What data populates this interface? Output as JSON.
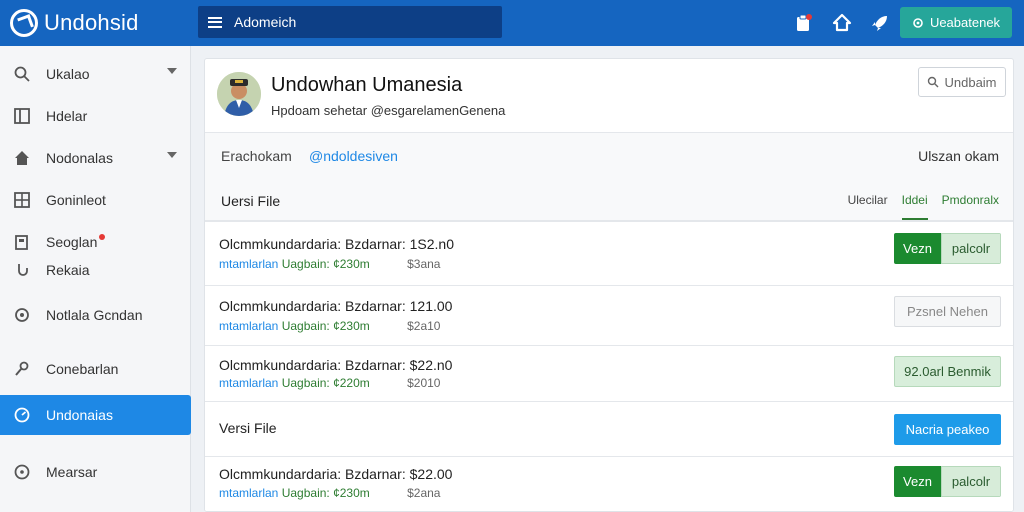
{
  "topbar": {
    "brand": "Undohsid",
    "search_text": "Adomeich",
    "action_button": "Ueabatenek",
    "icons": [
      "clipboard-alert-icon",
      "home-icon",
      "rocket-icon"
    ]
  },
  "sidebar": {
    "items": [
      {
        "label": "Ukalao",
        "icon": "search-icon",
        "chevron": true
      },
      {
        "label": "Hdelar",
        "icon": "panel-icon",
        "chevron": false
      },
      {
        "label": "Nodonalas",
        "icon": "home-icon",
        "chevron": true
      },
      {
        "label": "Goninleot",
        "icon": "grid-icon",
        "chevron": false
      },
      {
        "label": "Seoglan",
        "icon": "document-icon",
        "chevron": false,
        "dot": true
      },
      {
        "label": "Rekaia",
        "icon": "hook-icon",
        "chevron": false
      },
      {
        "label": "Notlala Gcndan",
        "icon": "gear-icon",
        "chevron": false
      },
      {
        "label": "Conebarlan",
        "icon": "wrench-icon",
        "chevron": false
      },
      {
        "label": "Undonaias",
        "icon": "compass-icon",
        "chevron": false,
        "active": true
      },
      {
        "label": "Mearsar",
        "icon": "info-icon",
        "chevron": false
      }
    ]
  },
  "profile": {
    "name": "Undowhan Umanesia",
    "subtitle": "Hpdoam sehetar @esgarelamenGenena",
    "button": "Undbaim"
  },
  "meta": {
    "left": "Erachokam",
    "link": "@ndoldesiven",
    "right": "Ulszan okam"
  },
  "section": {
    "title": "Uersi File",
    "tabs": [
      "Ulecilar",
      "Iddei",
      "Pmdonralx"
    ]
  },
  "rows": [
    {
      "line1": "Olcmmkundardaria: Bzdarnar: 1S2.n0",
      "a": "mtamlarlan",
      "b": "Uagbain: ¢230m",
      "c": "$3ana",
      "button_type": "pair",
      "btn1": "Vezn",
      "btn2": "palcolr"
    },
    {
      "line1": "Olcmmkundardaria: Bzdarnar: 121.00",
      "a": "mtamlarlan",
      "b": "Uagbain: ¢230m",
      "c": "$2a10",
      "button_type": "ghost",
      "btn1": "Pzsnel Nehen"
    },
    {
      "line1": "Olcmmkundardaria: Bzdarnar: $22.n0",
      "a": "mtamlarlan",
      "b": "Uagbain: ¢220m",
      "c": "$2010",
      "button_type": "lightgreen",
      "btn1": "92.0arl Benmik"
    },
    {
      "line1": "Olcmmkundardaria: Bzdarnar: $22.00",
      "a": "mtamlarlan",
      "b": "Uagbain: ¢230m",
      "c": "$2ana",
      "button_type": "pair",
      "btn1": "Vezn",
      "btn2": "palcolr"
    }
  ],
  "version_divider": {
    "title": "Versi File",
    "button": "Nacria peakeo"
  },
  "colors": {
    "primary": "#1565c0",
    "accent": "#1e88e5",
    "success": "#1b8a2f",
    "teal": "#26a69a"
  }
}
